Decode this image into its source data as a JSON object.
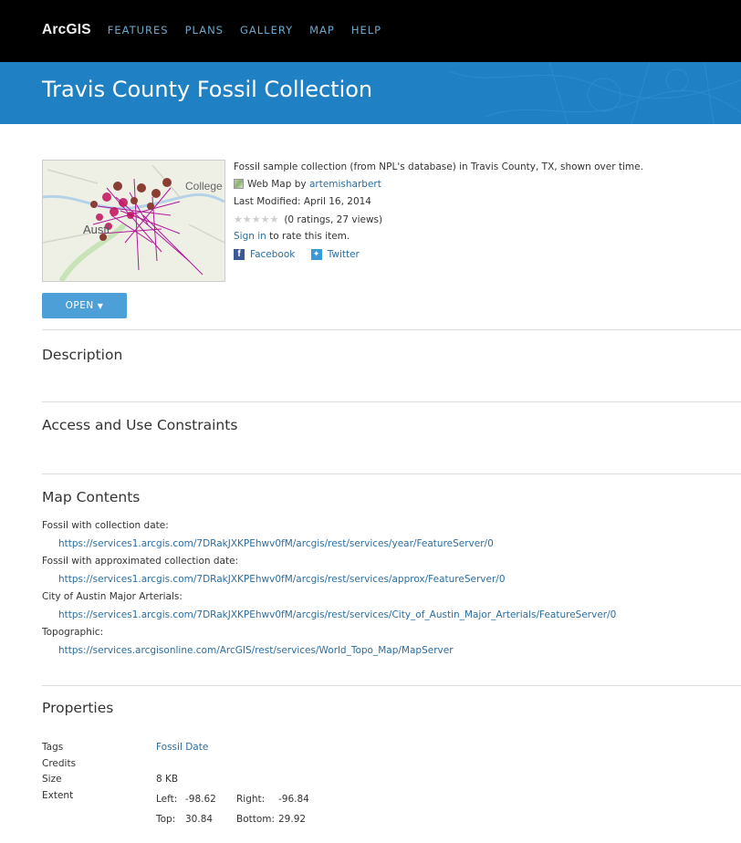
{
  "nav": {
    "brand": "ArcGIS",
    "links": [
      "FEATURES",
      "PLANS",
      "GALLERY",
      "MAP",
      "HELP"
    ]
  },
  "banner": {
    "title": "Travis County Fossil Collection"
  },
  "thumbnail": {
    "labels": [
      "College",
      "Austi"
    ]
  },
  "summary": {
    "description": "Fossil sample collection (from NPL's database) in Travis County, TX, shown over time.",
    "type_prefix": "Web Map by ",
    "owner": "artemisharbert",
    "last_modified": "Last Modified: April 16, 2014",
    "rating_stars": "★★★★★",
    "rating_text": "(0 ratings, 27 views)",
    "sign_in": "Sign in",
    "rate_text": " to rate this item.",
    "facebook": "Facebook",
    "twitter": "Twitter"
  },
  "open_button": {
    "label": "OPEN",
    "caret": "▼"
  },
  "sections": {
    "description": "Description",
    "access": "Access and Use Constraints",
    "contents": "Map Contents",
    "properties": "Properties"
  },
  "map_contents": [
    {
      "name": "Fossil with collection date:",
      "url": "https://services1.arcgis.com/7DRakJXKPEhwv0fM/arcgis/rest/services/year/FeatureServer/0"
    },
    {
      "name": "Fossil with approximated collection date:",
      "url": "https://services1.arcgis.com/7DRakJXKPEhwv0fM/arcgis/rest/services/approx/FeatureServer/0"
    },
    {
      "name": "City of Austin Major Arterials:",
      "url": "https://services1.arcgis.com/7DRakJXKPEhwv0fM/arcgis/rest/services/City_of_Austin_Major_Arterials/FeatureServer/0"
    },
    {
      "name": "Topographic:",
      "url": "https://services.arcgisonline.com/ArcGIS/rest/services/World_Topo_Map/MapServer"
    }
  ],
  "properties": {
    "tags_label": "Tags",
    "tags_value": "Fossil Date",
    "credits_label": "Credits",
    "size_label": "Size",
    "size_value": "8 KB",
    "extent_label": "Extent",
    "extent": {
      "left_label": "Left:",
      "left": "-98.62",
      "right_label": "Right:",
      "right": "-96.84",
      "top_label": "Top:",
      "top": "30.84",
      "bottom_label": "Bottom:",
      "bottom": "29.92"
    }
  },
  "colors": {
    "banner": "#1f80c4",
    "link": "#2c6e9f",
    "open_button": "#4d9fd8",
    "nav_link": "#6fa6c7"
  }
}
